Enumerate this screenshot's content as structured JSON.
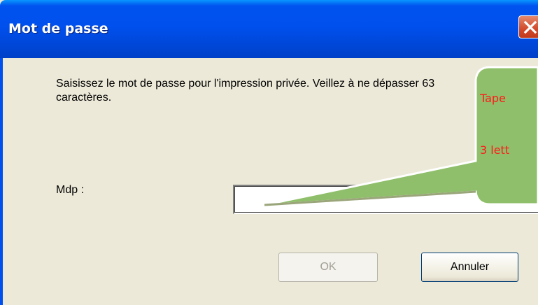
{
  "window": {
    "title": "Mot de passe"
  },
  "dialog": {
    "message": "Saisissez le mot de passe pour l'impression privée. Veillez à ne dépasser 63 caractères.",
    "field_label": "Mdp :",
    "password_value": "",
    "ok_label": "OK",
    "cancel_label": "Annuler"
  },
  "callout": {
    "line1": "Tape",
    "line2": "3 lett"
  },
  "colors": {
    "titlebar": "#0050ee",
    "dialog_bg": "#ece9d8",
    "callout_fill": "#8fbf6a",
    "callout_text": "#ff1a1a",
    "close_button": "#d24a2b"
  },
  "icons": {
    "close": "close-x-icon"
  }
}
